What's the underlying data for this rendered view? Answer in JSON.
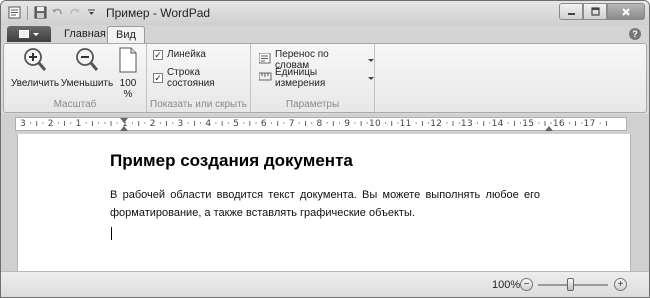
{
  "window": {
    "title": "Пример - WordPad"
  },
  "tabs": {
    "home_label": "Главная",
    "view_label": "Вид",
    "help_label": "?"
  },
  "ribbon": {
    "zoom_group": {
      "label": "Масштаб",
      "zoom_in_label": "Увеличить",
      "zoom_out_label": "Уменьшить",
      "hundred_label_1": "100",
      "hundred_label_2": "%"
    },
    "show_group": {
      "label": "Показать или скрыть",
      "ruler_label": "Линейка",
      "ruler_checked": true,
      "statusbar_label": "Строка состояния",
      "statusbar_checked": true
    },
    "params_group": {
      "label": "Параметры",
      "wrap_label": "Перенос по словам",
      "units_label": "Единицы измерения"
    }
  },
  "ruler": {
    "text": "3 · ı · 2 · ı · 1 · ı ·   · ı · 1 · ı · 2 · ı · 3 · ı · 4 · ı · 5 · ı · 6 · ı · 7 · ı · 8 · ı · 9 · ı ·10 · ı ·11 · ı ·12 · ı ·13 · ı ·14 · ı ·15 · ı ·16 · ı ·17 · ı"
  },
  "document": {
    "heading": "Пример создания документа",
    "body": "В рабочей области вводится текст документа. Вы можете выполнять любое его форматирование, а также вставлять графические объекты."
  },
  "statusbar": {
    "zoom_value": "100%",
    "zoom_minus": "−",
    "zoom_plus": "+",
    "zoom_level": 1.0
  }
}
